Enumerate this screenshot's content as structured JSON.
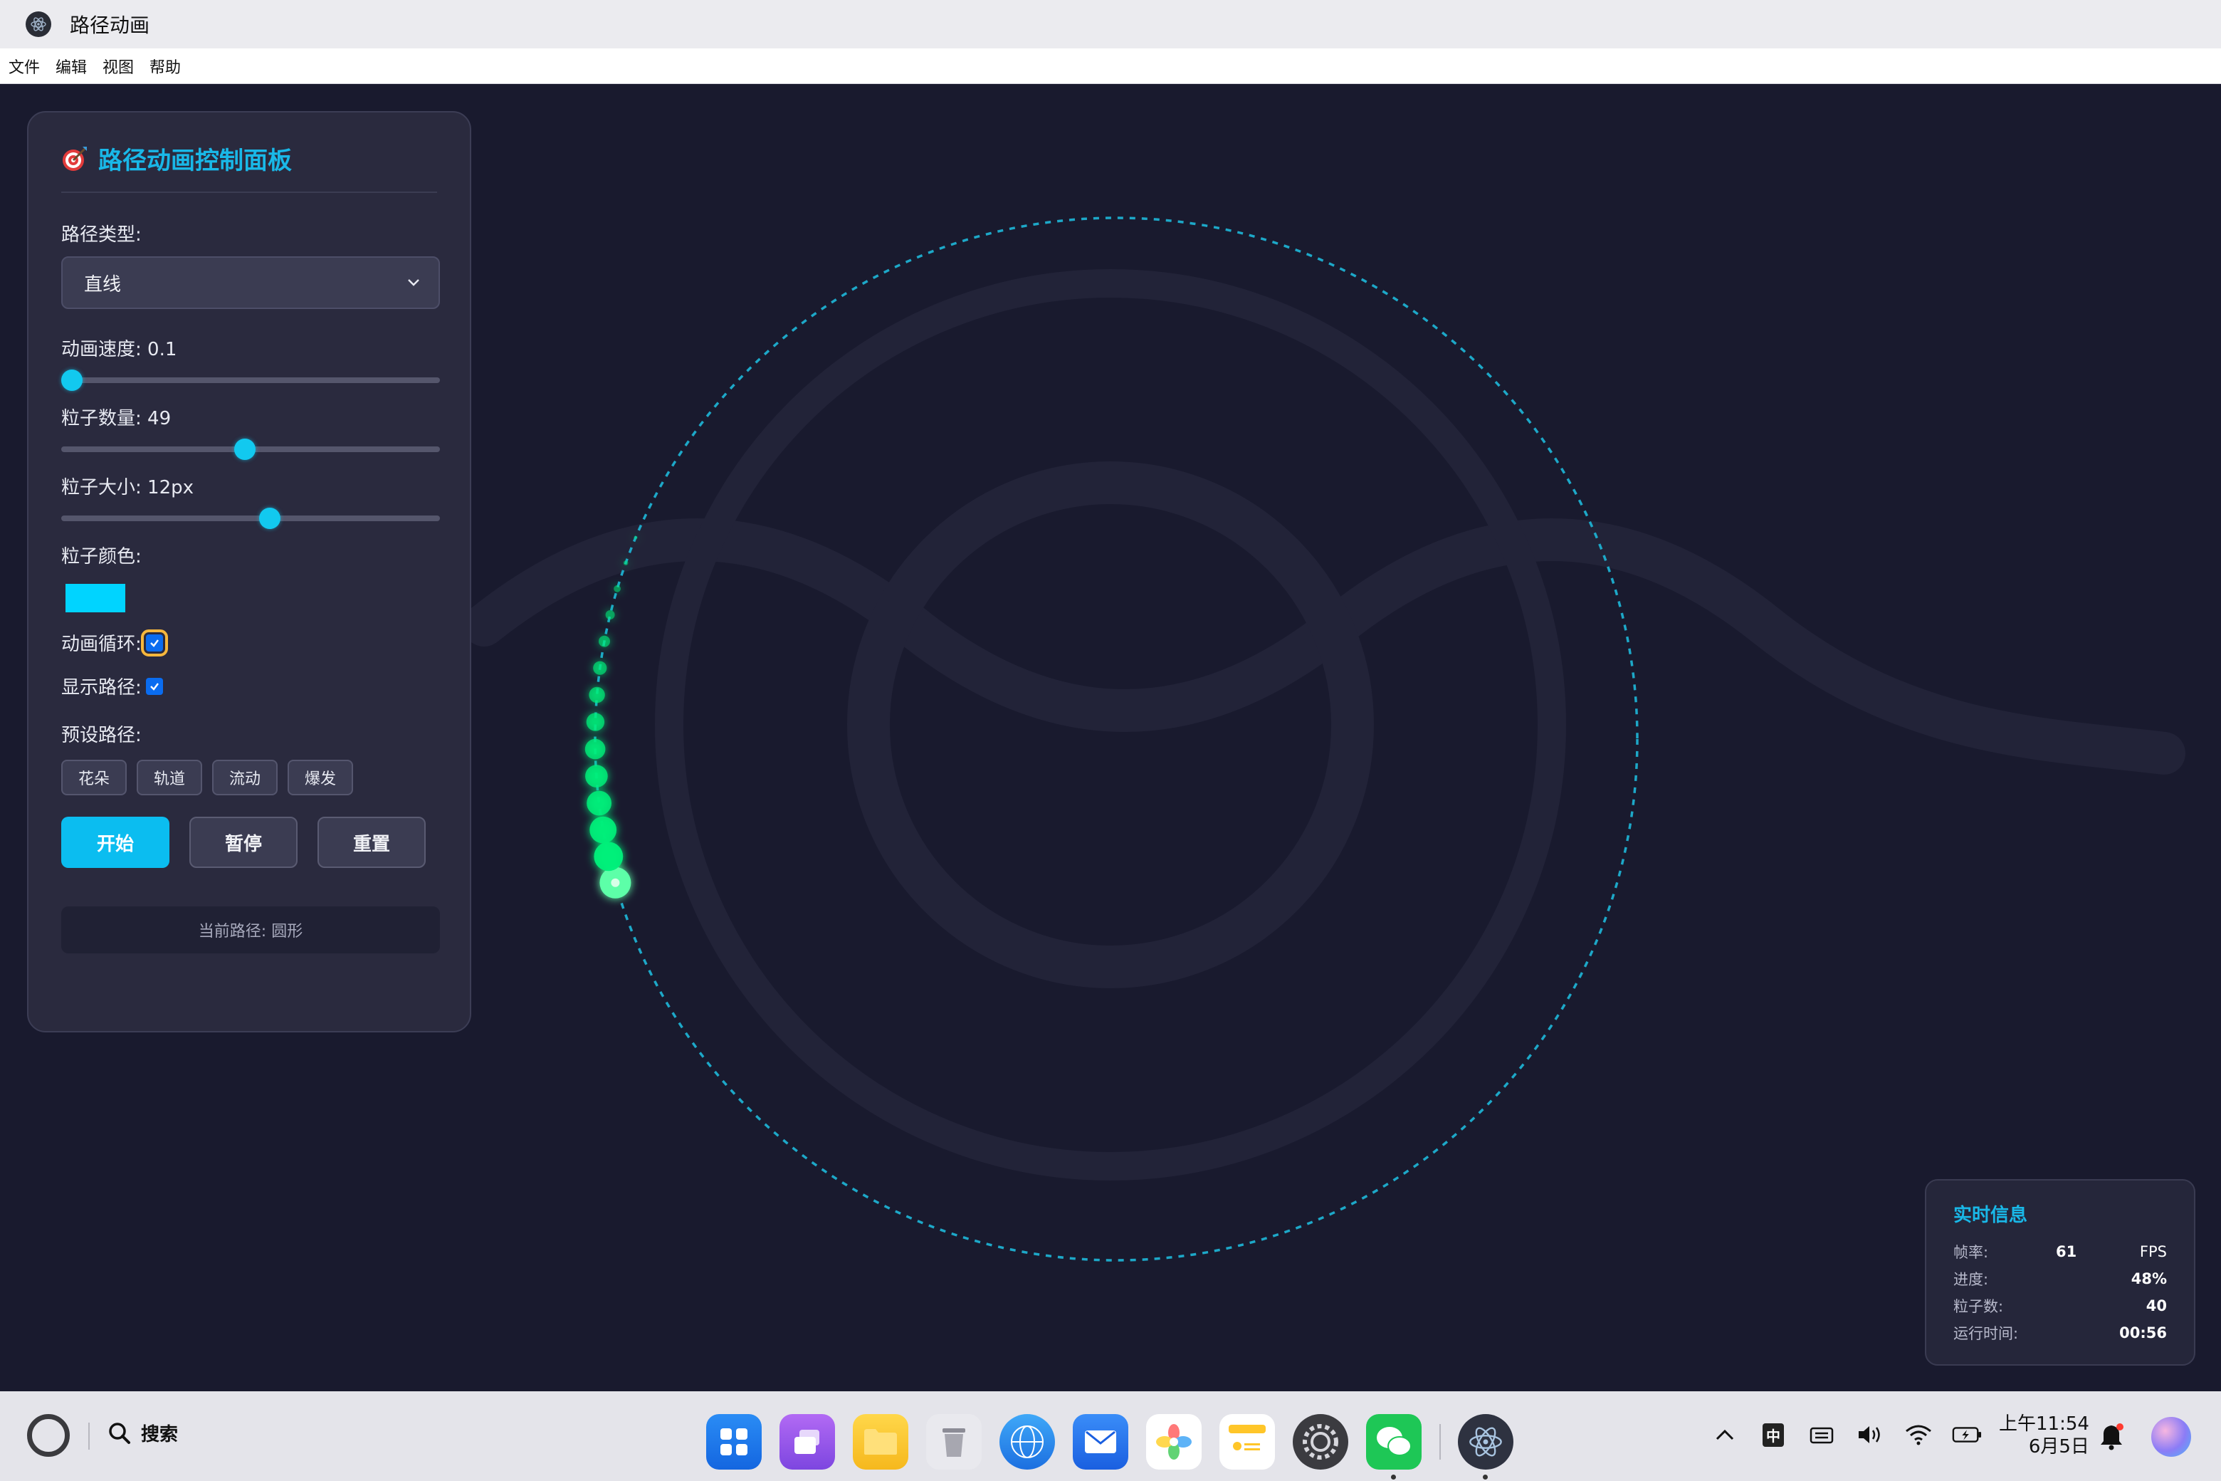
{
  "window": {
    "title": "路径动画"
  },
  "menu": [
    "文件",
    "编辑",
    "视图",
    "帮助"
  ],
  "panel": {
    "title": "路径动画控制面板",
    "path_type_label": "路径类型:",
    "path_type_value": "直线",
    "speed_label": "动画速度: 0.1",
    "speed_value": 0.1,
    "count_label": "粒子数量: 49",
    "count_value": 49,
    "size_label": "粒子大小: 12px",
    "size_value": 12,
    "color_label": "粒子颜色:",
    "color_value": "#00d4ff",
    "loop_label": "动画循环:",
    "loop_checked": true,
    "show_path_label": "显示路径:",
    "show_path_checked": true,
    "presets_label": "预设路径:",
    "presets": [
      "花朵",
      "轨道",
      "流动",
      "爆发"
    ],
    "start_label": "开始",
    "pause_label": "暂停",
    "reset_label": "重置",
    "current_path": "当前路径: 圆形"
  },
  "info": {
    "title": "实时信息",
    "fps_label": "帧率:",
    "fps_value": "61",
    "fps_unit": "FPS",
    "progress_label": "进度:",
    "progress_value": "48%",
    "particles_label": "粒子数:",
    "particles_value": "40",
    "runtime_label": "运行时间:",
    "runtime_value": "00:56"
  },
  "taskbar": {
    "search_label": "搜索",
    "dock": [
      "launcher-icon",
      "multitask-icon",
      "files-icon",
      "trash-icon",
      "browser-icon",
      "mail-icon",
      "photos-icon",
      "notes-icon",
      "settings-icon",
      "wechat-icon",
      "electron-app-icon"
    ],
    "ime_label": "中",
    "time": "上午11:54",
    "date": "6月5日"
  },
  "colors": {
    "accent": "#19b8e8",
    "particle": "#00ff88",
    "path": "#1da8c8",
    "background": "#191a2e"
  }
}
